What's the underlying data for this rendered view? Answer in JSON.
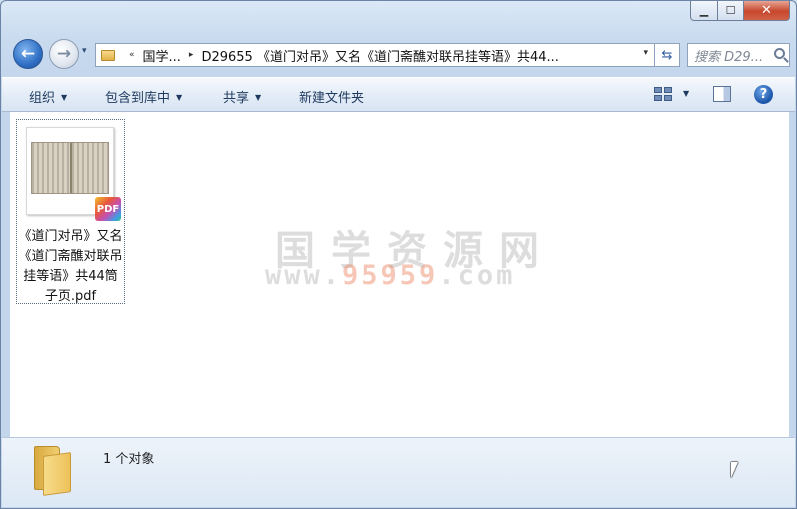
{
  "window": {
    "caption": {
      "minimize": "▁",
      "maximize": "☐",
      "close": "✕"
    }
  },
  "nav": {
    "back_icon": "back-arrow-icon",
    "back_glyph": "←",
    "forward_glyph": "→",
    "history_glyph": "▾",
    "breadcrumb": [
      "«",
      "国学...",
      "▸",
      "D29655 《道门对吊》又名《道门斋醮对联吊挂等语》共44..."
    ],
    "address_drop_glyph": "▾",
    "refresh_glyph": "⇆",
    "search_placeholder": "搜索 D29..."
  },
  "toolbar": {
    "organize": "组织",
    "include_library": "包含到库中",
    "share": "共享",
    "new_folder": "新建文件夹",
    "arrow": "▼",
    "help": "?"
  },
  "content": {
    "file": {
      "name": "《道门对吊》又名《道门斋醮对联吊挂等语》共44筒子页.pdf",
      "badge": "PDF"
    },
    "watermark": {
      "line1": "国学资源网",
      "line2_pre": "www.",
      "line2_hl": "95959",
      "line2_post": ".com"
    }
  },
  "status": {
    "text": "1 个对象"
  }
}
